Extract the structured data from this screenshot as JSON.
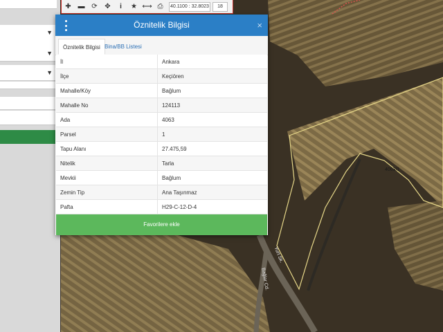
{
  "toolbar": {
    "coords": "40.1100 : 32.8023",
    "zoom": "18",
    "buttons": [
      "zoom-in-icon",
      "zoom-out-icon",
      "refresh-icon",
      "move-icon",
      "info-icon",
      "star-icon",
      "measure-icon",
      "print-icon"
    ]
  },
  "dialog": {
    "title": "Öznitelik Bilgisi",
    "close": "×",
    "tabs": [
      "Öznitelik Bilgisi",
      "Bina/BB Listesi"
    ],
    "rows": [
      {
        "key": "İl",
        "value": "Ankara"
      },
      {
        "key": "İlçe",
        "value": "Keçiören"
      },
      {
        "key": "Mahalle/Köy",
        "value": "Bağlum"
      },
      {
        "key": "Mahalle No",
        "value": "124113"
      },
      {
        "key": "Ada",
        "value": "4063"
      },
      {
        "key": "Parsel",
        "value": "1"
      },
      {
        "key": "Tapu Alanı",
        "value": "27.475,59"
      },
      {
        "key": "Nitelik",
        "value": "Tarla"
      },
      {
        "key": "Mevkii",
        "value": "Bağlum"
      },
      {
        "key": "Zemin Tip",
        "value": "Ana Taşınmaz"
      },
      {
        "key": "Pafta",
        "value": "H29-C-12-D-4"
      }
    ],
    "favorite_button": "Favorilere ekle"
  },
  "map": {
    "parcel_label": "4063/1",
    "street_label_1": "Yurt Sk.",
    "street_label_2": "Bağlar Cd."
  },
  "colors": {
    "header_blue": "#2b7fc6",
    "green_button": "#5cb85c",
    "parcel_outline": "#e8d98a"
  }
}
